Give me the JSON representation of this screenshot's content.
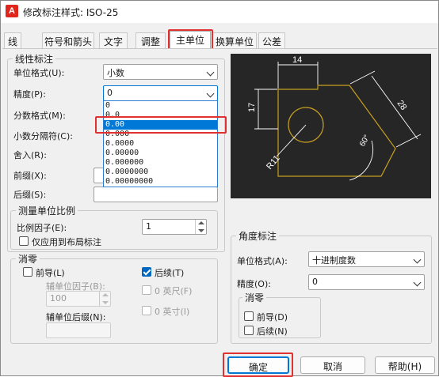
{
  "window": {
    "title": "修改标注样式: ISO-25",
    "app_icon_letter": "A"
  },
  "tabs": [
    "线",
    "符号和箭头",
    "文字",
    "调整",
    "主单位",
    "换算单位",
    "公差"
  ],
  "linear": {
    "legend": "线性标注",
    "unit_format_label": "单位格式(U):",
    "unit_format_value": "小数",
    "precision_label": "精度(P):",
    "precision_value": "0",
    "fraction_format_label": "分数格式(M):",
    "decimal_sep_label": "小数分隔符(C):",
    "round_label": "舍入(R):",
    "prefix_label": "前缀(X):",
    "suffix_label": "后缀(S):"
  },
  "precision_options": [
    "0",
    "0.0",
    "0.00",
    "0.000",
    "0.0000",
    "0.00000",
    "0.000000",
    "0.0000000",
    "0.00000000"
  ],
  "precision_selected_index": 2,
  "scale": {
    "legend": "测量单位比例",
    "factor_label": "比例因子(E):",
    "factor_value": "1",
    "layout_only_label": "仅应用到布局标注"
  },
  "zero_left": {
    "legend": "消零",
    "leading_label": "前导(L)",
    "sub_factor_label": "辅单位因子(B):",
    "sub_factor_value": "100",
    "sub_suffix_label": "辅单位后缀(N):",
    "trailing_label": "后续(T)",
    "feet_label": "0 英尺(F)",
    "inches_label": "0 英寸(I)"
  },
  "preview": {
    "dim_14": "14",
    "dim_17": "17",
    "dim_28": "28",
    "dim_60": "60°",
    "dim_r11": "R11"
  },
  "angular": {
    "legend": "角度标注",
    "unit_format_label": "单位格式(A):",
    "unit_format_value": "十进制度数",
    "precision_label": "精度(O):",
    "precision_value": "0",
    "zero_legend": "消零",
    "leading_label": "前导(D)",
    "trailing_label": "后续(N)"
  },
  "buttons": {
    "ok": "确定",
    "cancel": "取消",
    "help": "帮助(H)"
  },
  "colors": {
    "accent": "#0078d4",
    "highlight": "#e03030",
    "preview_bg": "#262626",
    "preview_line": "#c8a020"
  }
}
